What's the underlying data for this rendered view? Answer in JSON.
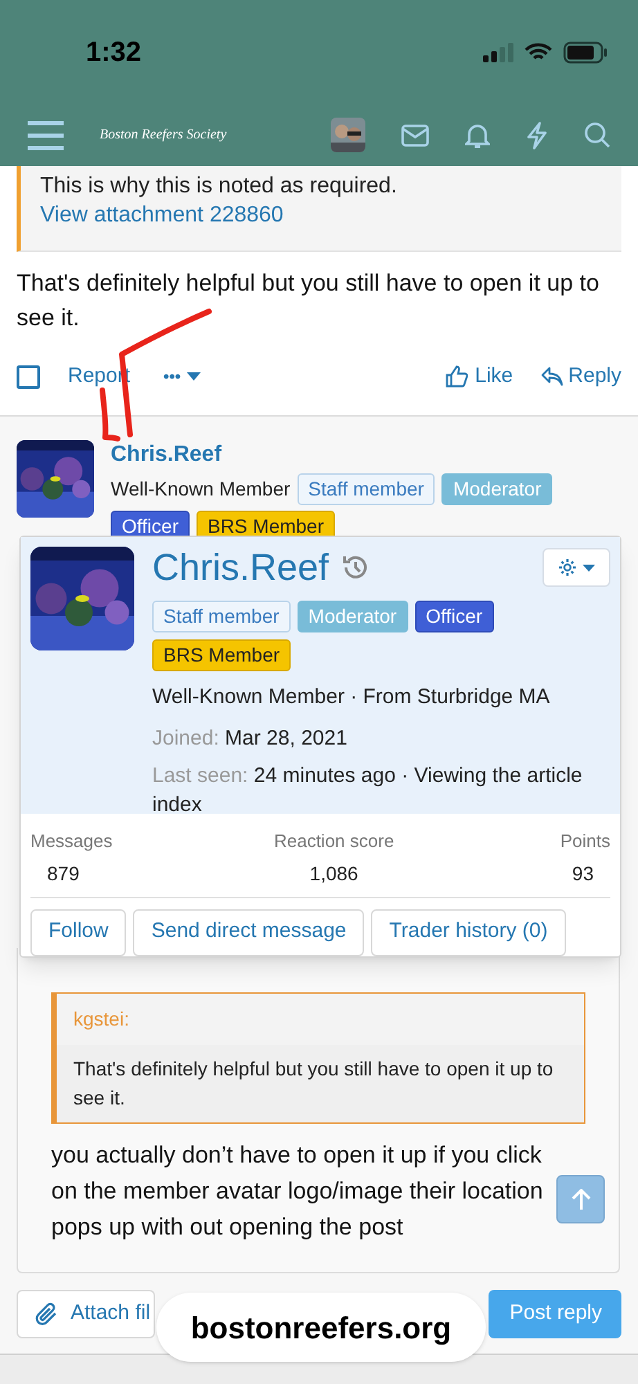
{
  "status_bar": {
    "time": "1:32"
  },
  "header": {
    "site_title": "Boston Reefers Society"
  },
  "quoted_post": {
    "text": "This is why this is noted as required.",
    "link": "View attachment 228860"
  },
  "post": {
    "text": "That's definitely helpful but you still have to open it up to see it.",
    "actions": {
      "report": "Report",
      "more": "•••",
      "like": "Like",
      "reply": "Reply"
    },
    "checked": false
  },
  "next_post": {
    "author": "Chris.Reef",
    "title": "Well-Known Member",
    "badges": [
      {
        "label": "Staff member",
        "kind": "staff"
      },
      {
        "label": "Moderator",
        "kind": "moderator"
      },
      {
        "label": "Officer",
        "kind": "officer"
      },
      {
        "label": "BRS Member",
        "kind": "brs"
      }
    ]
  },
  "member_card": {
    "name": "Chris.Reef",
    "badges": [
      {
        "label": "Staff member",
        "kind": "staff"
      },
      {
        "label": "Moderator",
        "kind": "moderator"
      },
      {
        "label": "Officer",
        "kind": "officer"
      },
      {
        "label": "BRS Member",
        "kind": "brs"
      }
    ],
    "info": "Well-Known Member · From Sturbridge MA",
    "joined_label": "Joined:",
    "joined": "Mar 28, 2021",
    "last_seen_label": "Last seen:",
    "last_seen": "24 minutes ago · Viewing the article index",
    "stats": [
      {
        "label": "Messages",
        "value": "879"
      },
      {
        "label": "Reaction score",
        "value": "1,086"
      },
      {
        "label": "Points",
        "value": "93"
      }
    ],
    "buttons": [
      "Follow",
      "Send direct message",
      "Trader history (0)"
    ]
  },
  "editor": {
    "quote_author": "kgstei:",
    "quote_text": "That's definitely helpful but you still have to open it up to see it.",
    "text": "you actually don’t have to open it up if you click on the member avatar logo/image their location pops up with out opening the post"
  },
  "footer": {
    "attach": "Attach fil",
    "post_reply": "Post reply"
  },
  "url_bar": {
    "url": "bostonreefers.org"
  }
}
